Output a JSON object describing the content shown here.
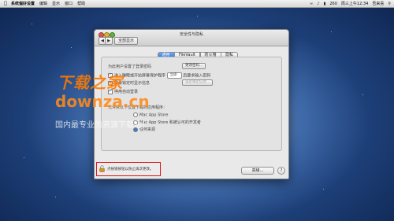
{
  "menubar": {
    "app_name": "系统偏好设置",
    "menus": [
      "编辑",
      "显示",
      "窗口",
      "帮助"
    ],
    "battery": "260",
    "clock": "周三上午12:34",
    "user": "吾来喜"
  },
  "window": {
    "title": "安全性与隐私",
    "show_all": "全部显示",
    "tabs": [
      "通用",
      "FileVault",
      "防火墙",
      "隐私"
    ],
    "active_tab": "通用",
    "password_row": "为此用户设置了登录密码",
    "change_password": "更改密码...",
    "require_password_label": "进入睡眠或开始屏幕保护程序",
    "require_password_select": "立即",
    "require_password_suffix": "后要求输入密码",
    "show_message_label": "屏幕锁定时显示信息",
    "set_lock_message": "设定锁定信息...",
    "disable_auto_login": "停用自动登录",
    "allow_apps_label": "允许从以下位置下载的应用程序：",
    "option_app_store": "Mac App Store",
    "option_identified": "Mac App Store 和被认可的开发者",
    "option_anywhere": "任何来源",
    "lock_text": "点按锁按钮以防止再次更改。",
    "advanced_button": "高级...",
    "help_button": "?"
  },
  "watermark": {
    "logo": "下载之家",
    "url": "downza.cn",
    "slogan": "国内最专业的资源下载站！"
  }
}
